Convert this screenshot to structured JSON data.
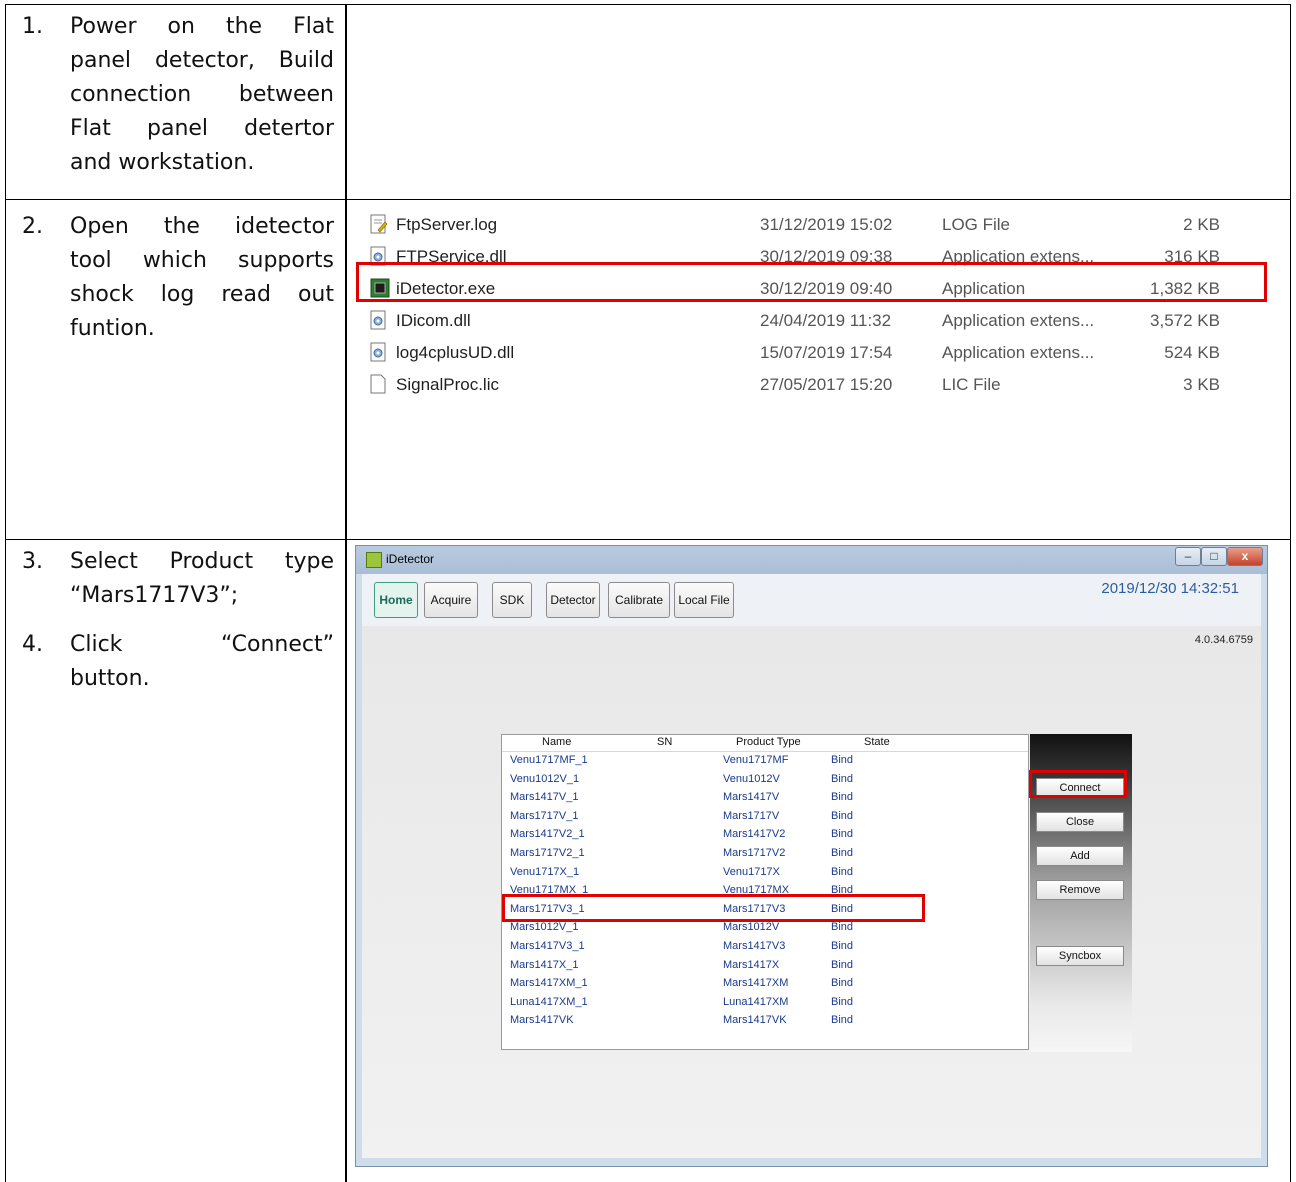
{
  "steps": [
    {
      "num": "1.",
      "lines": [
        "Power on the Flat",
        "panel detector, Build",
        "connection between",
        "Flat panel detertor"
      ],
      "last": "and workstation."
    },
    {
      "num": "2.",
      "lines": [
        "Open the idetector",
        "tool which supports",
        "shock log read out"
      ],
      "last": "funtion."
    },
    {
      "num": "3.",
      "lines": [
        "Select Product type"
      ],
      "last": "“Mars1717V3”;"
    },
    {
      "num": "4.",
      "lines": [
        "Click “Connect”"
      ],
      "last": "button."
    }
  ],
  "files": [
    {
      "name": "FtpServer.log",
      "date": "31/12/2019 15:02",
      "type": "LOG File",
      "size": "2 KB",
      "icon": "log-file-icon"
    },
    {
      "name": "FTPService.dll",
      "date": "30/12/2019 09:38",
      "type": "Application extens...",
      "size": "316 KB",
      "icon": "dll-file-icon"
    },
    {
      "name": "iDetector.exe",
      "date": "30/12/2019 09:40",
      "type": "Application",
      "size": "1,382 KB",
      "icon": "exe-file-icon"
    },
    {
      "name": "IDicom.dll",
      "date": "24/04/2019 11:32",
      "type": "Application extens...",
      "size": "3,572 KB",
      "icon": "dll-file-icon"
    },
    {
      "name": "log4cplusUD.dll",
      "date": "15/07/2019 17:54",
      "type": "Application extens...",
      "size": "524 KB",
      "icon": "dll-file-icon"
    },
    {
      "name": "SignalProc.lic",
      "date": "27/05/2017 15:20",
      "type": "LIC File",
      "size": "3 KB",
      "icon": "blank-file-icon"
    }
  ],
  "window": {
    "title": "iDetector",
    "datetime": "2019/12/30 14:32:51",
    "version": "4.0.34.6759",
    "tabs": [
      "Home",
      "Acquire",
      "SDK",
      "Detector",
      "Calibrate",
      "Local File"
    ],
    "controls": {
      "minimize": "–",
      "maximize": "□",
      "close": "x"
    }
  },
  "devices": {
    "columns": [
      "Name",
      "SN",
      "Product Type",
      "State"
    ],
    "rows": [
      [
        "Venu1717MF_1",
        "",
        "Venu1717MF",
        "Bind"
      ],
      [
        "Venu1012V_1",
        "",
        "Venu1012V",
        "Bind"
      ],
      [
        "Mars1417V_1",
        "",
        "Mars1417V",
        "Bind"
      ],
      [
        "Mars1717V_1",
        "",
        "Mars1717V",
        "Bind"
      ],
      [
        "Mars1417V2_1",
        "",
        "Mars1417V2",
        "Bind"
      ],
      [
        "Mars1717V2_1",
        "",
        "Mars1717V2",
        "Bind"
      ],
      [
        "Venu1717X_1",
        "",
        "Venu1717X",
        "Bind"
      ],
      [
        "Venu1717MX_1",
        "",
        "Venu1717MX",
        "Bind"
      ],
      [
        "Mars1717V3_1",
        "",
        "Mars1717V3",
        "Bind"
      ],
      [
        "Mars1012V_1",
        "",
        "Mars1012V",
        "Bind"
      ],
      [
        "Mars1417V3_1",
        "",
        "Mars1417V3",
        "Bind"
      ],
      [
        "Mars1417X_1",
        "",
        "Mars1417X",
        "Bind"
      ],
      [
        "Mars1417XM_1",
        "",
        "Mars1417XM",
        "Bind"
      ],
      [
        "Luna1417XM_1",
        "",
        "Luna1417XM",
        "Bind"
      ],
      [
        "Mars1417VK",
        "",
        "Mars1417VK",
        "Bind"
      ]
    ]
  },
  "side_buttons": [
    "Connect",
    "Close",
    "Add",
    "Remove",
    "Syncbox"
  ],
  "colors": {
    "highlight": "#e00000",
    "accent": "#2a5d9e",
    "device_text": "#1a3a8a"
  }
}
